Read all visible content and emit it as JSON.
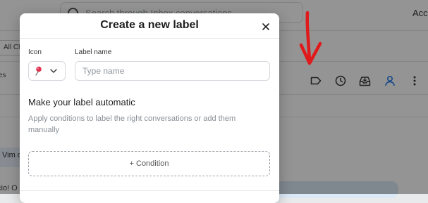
{
  "background": {
    "search_placeholder": "Search through Inbox conversations",
    "account_label": "Acc",
    "filter_chip": "All Ch",
    "row_label": "es",
    "message_preview": "Vim d",
    "message_preview_2": "cio! O",
    "toolbar_icons": [
      "label-icon",
      "snooze-clock-icon",
      "archive-tray-icon",
      "assign-user-icon",
      "more-vertical-icon"
    ],
    "accent_color": "#1a73e8"
  },
  "annotation": {
    "arrow_color": "#e0191b"
  },
  "modal": {
    "title": "Create a new label",
    "close_icon": "close-icon",
    "icon_field_label": "Icon",
    "name_field_label": "Label name",
    "name_input_value": "",
    "name_input_placeholder": "Type name",
    "selected_icon": "pushpin-icon",
    "automation_title": "Make your label automatic",
    "automation_description": "Apply conditions to label the right conversations or add them manually",
    "add_condition_label": "+ Condition"
  }
}
